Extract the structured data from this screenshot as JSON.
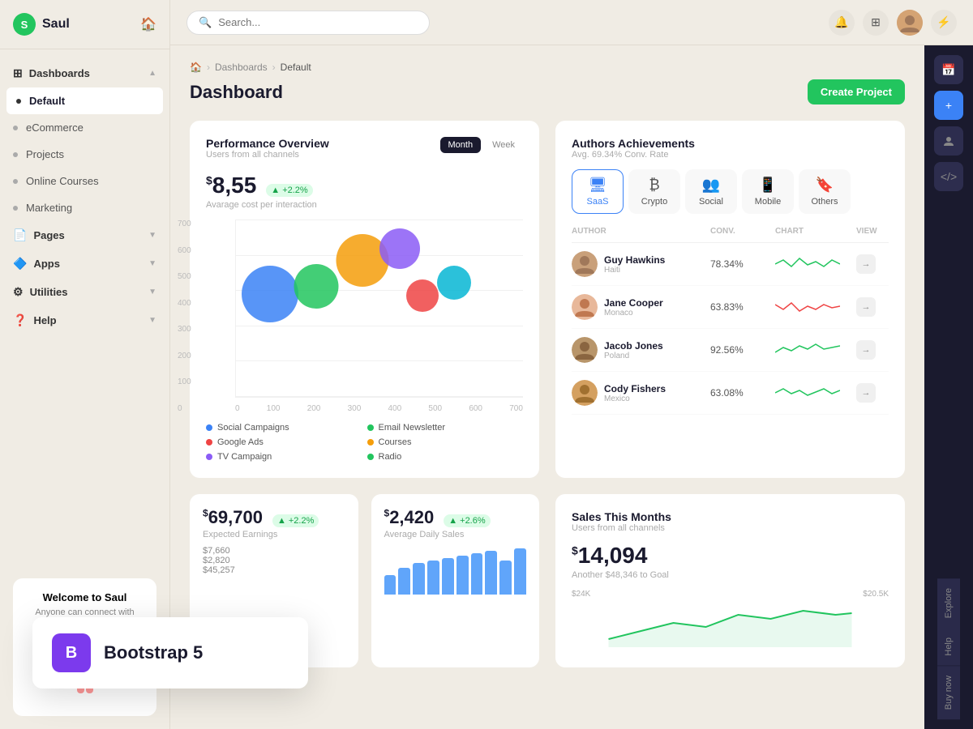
{
  "app": {
    "name": "Saul",
    "logo_letter": "S"
  },
  "topbar": {
    "search_placeholder": "Search...",
    "search_label": "Search _"
  },
  "sidebar": {
    "nav_items": [
      {
        "id": "dashboards",
        "label": "Dashboards",
        "type": "group",
        "has_chevron": true,
        "icon": "⊞"
      },
      {
        "id": "default",
        "label": "Default",
        "type": "sub",
        "active": true
      },
      {
        "id": "ecommerce",
        "label": "eCommerce",
        "type": "sub"
      },
      {
        "id": "projects",
        "label": "Projects",
        "type": "sub"
      },
      {
        "id": "online-courses",
        "label": "Online Courses",
        "type": "sub"
      },
      {
        "id": "marketing",
        "label": "Marketing",
        "type": "sub"
      },
      {
        "id": "pages",
        "label": "Pages",
        "type": "group",
        "has_chevron": true,
        "icon": "📄"
      },
      {
        "id": "apps",
        "label": "Apps",
        "type": "group",
        "has_chevron": true,
        "icon": "🔷"
      },
      {
        "id": "utilities",
        "label": "Utilities",
        "type": "group",
        "has_chevron": true,
        "icon": "⚙"
      },
      {
        "id": "help",
        "label": "Help",
        "type": "group",
        "has_chevron": true,
        "icon": "❓"
      }
    ],
    "welcome": {
      "title": "Welcome to Saul",
      "subtitle": "Anyone can connect with their audience blogging"
    }
  },
  "breadcrumb": {
    "home": "🏠",
    "section": "Dashboards",
    "current": "Default"
  },
  "page": {
    "title": "Dashboard",
    "create_button": "Create Project"
  },
  "performance": {
    "title": "Performance Overview",
    "subtitle": "Users from all channels",
    "period_month": "Month",
    "period_week": "Week",
    "metric_value": "8,55",
    "metric_symbol": "$",
    "metric_badge": "+2.2%",
    "metric_label": "Avarage cost per interaction",
    "y_labels": [
      "700",
      "600",
      "500",
      "400",
      "300",
      "200",
      "100",
      "0"
    ],
    "x_labels": [
      "0",
      "100",
      "200",
      "300",
      "400",
      "500",
      "600",
      "700"
    ],
    "bubbles": [
      {
        "x": 18,
        "y": 45,
        "size": 70,
        "color": "#3b82f6"
      },
      {
        "x": 30,
        "y": 40,
        "size": 55,
        "color": "#22c55e"
      },
      {
        "x": 42,
        "y": 30,
        "size": 65,
        "color": "#f59e0b"
      },
      {
        "x": 55,
        "y": 22,
        "size": 48,
        "color": "#8b5cf6"
      },
      {
        "x": 63,
        "y": 38,
        "size": 38,
        "color": "#ef4444"
      },
      {
        "x": 73,
        "y": 32,
        "size": 42,
        "color": "#06b6d4"
      }
    ],
    "legend": [
      {
        "label": "Social Campaigns",
        "color": "#3b82f6"
      },
      {
        "label": "Email Newsletter",
        "color": "#22c55e"
      },
      {
        "label": "Google Ads",
        "color": "#ef4444"
      },
      {
        "label": "Courses",
        "color": "#f59e0b"
      },
      {
        "label": "TV Campaign",
        "color": "#8b5cf6"
      },
      {
        "label": "Radio",
        "color": "#22c55e"
      }
    ]
  },
  "authors": {
    "title": "Authors Achievements",
    "subtitle": "Avg. 69.34% Conv. Rate",
    "categories": [
      {
        "id": "saas",
        "label": "SaaS",
        "icon": "🖥",
        "active": true
      },
      {
        "id": "crypto",
        "label": "Crypto",
        "icon": "₿"
      },
      {
        "id": "social",
        "label": "Social",
        "icon": "👥"
      },
      {
        "id": "mobile",
        "label": "Mobile",
        "icon": "📱"
      },
      {
        "id": "others",
        "label": "Others",
        "icon": "🔖"
      }
    ],
    "table_headers": [
      "AUTHOR",
      "CONV.",
      "CHART",
      "VIEW"
    ],
    "authors": [
      {
        "name": "Guy Hawkins",
        "location": "Haiti",
        "conv": "78.34%",
        "wave_color": "#22c55e"
      },
      {
        "name": "Jane Cooper",
        "location": "Monaco",
        "conv": "63.83%",
        "wave_color": "#ef4444"
      },
      {
        "name": "Jacob Jones",
        "location": "Poland",
        "conv": "92.56%",
        "wave_color": "#22c55e"
      },
      {
        "name": "Cody Fishers",
        "location": "Mexico",
        "conv": "63.08%",
        "wave_color": "#22c55e"
      }
    ]
  },
  "stats": {
    "earnings": {
      "value": "69,700",
      "symbol": "$",
      "badge": "+2.2%",
      "label": "Expected Earnings"
    },
    "daily_sales": {
      "value": "2,420",
      "symbol": "$",
      "badge": "+2.6%",
      "label": "Average Daily Sales"
    },
    "values": [
      "$7,660",
      "$2,820",
      "$45,257"
    ],
    "bars": [
      40,
      55,
      65,
      70,
      75,
      80,
      85,
      90,
      70,
      60
    ]
  },
  "sales": {
    "title": "Sales This Months",
    "subtitle": "Users from all channels",
    "value": "14,094",
    "symbol": "$",
    "goal_label": "Another $48,346 to Goal",
    "y_labels": [
      "$24K",
      "$20.5K"
    ]
  },
  "right_panel": {
    "labels": [
      "Explore",
      "Help",
      "Buy now"
    ],
    "icons": [
      "📅",
      "+",
      "👤",
      "⚡"
    ]
  },
  "bootstrap": {
    "letter": "B",
    "text": "Bootstrap 5"
  }
}
